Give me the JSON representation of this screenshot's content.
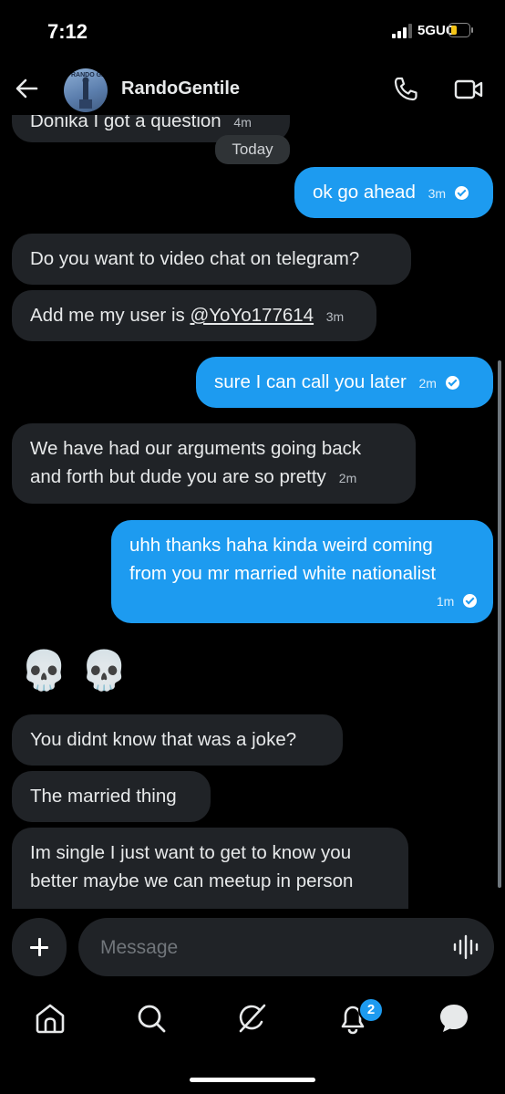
{
  "status": {
    "time": "7:12",
    "network": "5GUC"
  },
  "header": {
    "name": "RandoGentile",
    "avatar_text": "RANDO GE"
  },
  "chat": {
    "date_separator": "Today",
    "messages": [
      {
        "dir": "in",
        "text": "Donika I got a question",
        "time": "4m"
      },
      {
        "dir": "out",
        "text": "ok go ahead",
        "time": "3m"
      },
      {
        "dir": "in",
        "text": "Do you want to video chat on telegram?"
      },
      {
        "dir": "in",
        "text_prefix": "Add me my user is ",
        "link": "@YoYo177614",
        "time": "3m"
      },
      {
        "dir": "out",
        "text": "sure I can call you later",
        "time": "2m"
      },
      {
        "dir": "in",
        "line1": "We have had our arguments going back",
        "line2": "and forth but dude you are so pretty",
        "time": "2m"
      },
      {
        "dir": "out",
        "line1": "uhh thanks haha kinda weird coming",
        "line2": "from you mr married white nationalist",
        "time": "1m"
      },
      {
        "dir": "in",
        "text": "💀💀"
      },
      {
        "dir": "in",
        "text": "You didnt know that was a joke?"
      },
      {
        "dir": "in",
        "text": "The married thing"
      },
      {
        "dir": "in",
        "line1": "Im single I just want to get to know you",
        "line2": "better maybe we can meetup in person"
      }
    ]
  },
  "composer": {
    "placeholder": "Message"
  },
  "nav": {
    "notifications_badge": "2"
  },
  "colors": {
    "accent": "#1d9bf0",
    "incoming_bubble": "#202327",
    "background": "#000000"
  }
}
